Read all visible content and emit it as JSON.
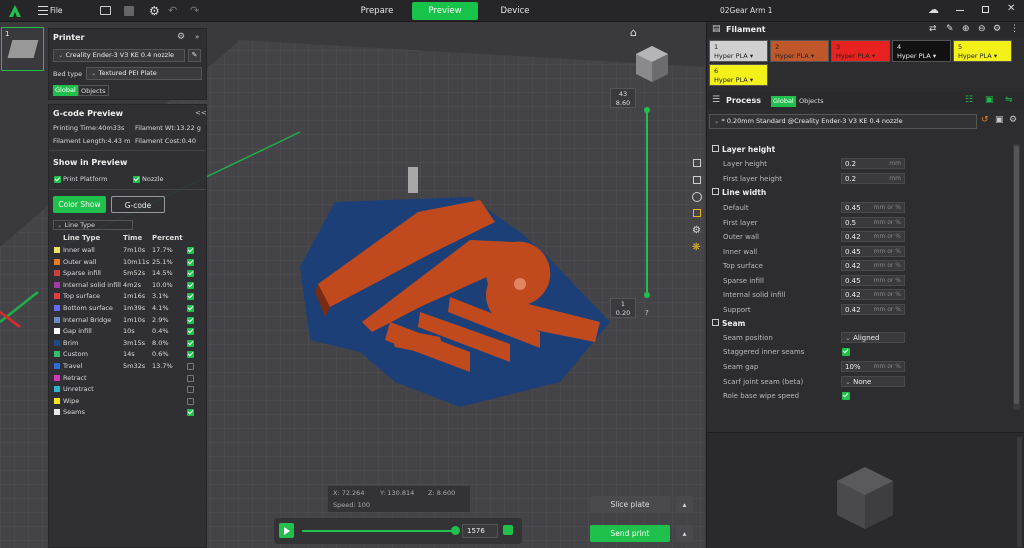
{
  "topbar": {
    "file": "File",
    "tabs": [
      "Prepare",
      "Preview",
      "Device"
    ],
    "title": "02Gear Arm 1"
  },
  "printer": {
    "heading": "Printer",
    "model": "Creality Ender-3 V3 KE 0.4 nozzle",
    "bed_label": "Bed type",
    "bed_value": "Textured PEI Plate",
    "global": "Global",
    "objects": "Objects"
  },
  "plate": {
    "number": "1"
  },
  "gcode": {
    "heading": "G-code Preview",
    "collapse": "<<",
    "print_time": "Printing Time:40m33s",
    "fil_wt": "Filament Wt:13.22 g",
    "fil_len": "Filament Length:4.43 m",
    "fil_cost": "Filament Cost:0.40",
    "show_heading": "Show in Preview",
    "print_platform": "Print Platform",
    "nozzle": "Nozzle",
    "color_show": "Color Show",
    "gcode_btn": "G-code",
    "line_type_select": "Line Type",
    "cols": [
      "Line Type",
      "Time",
      "Percent"
    ],
    "rows": [
      {
        "name": "Inner wall",
        "time": "7m10s",
        "pct": "17.7%",
        "color": "#f0e35a",
        "on": true
      },
      {
        "name": "Outer wall",
        "time": "10m11s",
        "pct": "25.1%",
        "color": "#e97c1f",
        "on": true
      },
      {
        "name": "Sparse infill",
        "time": "5m52s",
        "pct": "14.5%",
        "color": "#c9433a",
        "on": true
      },
      {
        "name": "Internal solid infill",
        "time": "4m2s",
        "pct": "10.0%",
        "color": "#a43aa8",
        "on": true
      },
      {
        "name": "Top surface",
        "time": "1m16s",
        "pct": "3.1%",
        "color": "#e23c44",
        "on": true
      },
      {
        "name": "Bottom surface",
        "time": "1m39s",
        "pct": "4.1%",
        "color": "#6a6cf0",
        "on": true
      },
      {
        "name": "Internal Bridge",
        "time": "1m10s",
        "pct": "2.9%",
        "color": "#6a8cc9",
        "on": true
      },
      {
        "name": "Gap infill",
        "time": "10s",
        "pct": "0.4%",
        "color": "#ffffff",
        "on": true
      },
      {
        "name": "Brim",
        "time": "3m15s",
        "pct": "8.0%",
        "color": "#1e4a8a",
        "on": true
      },
      {
        "name": "Custom",
        "time": "14s",
        "pct": "0.6%",
        "color": "#2bc26a",
        "on": true
      },
      {
        "name": "Travel",
        "time": "5m32s",
        "pct": "13.7%",
        "color": "#2b6cd6",
        "on": false
      },
      {
        "name": "Retract",
        "time": "",
        "pct": "",
        "color": "#d43ab8",
        "on": false
      },
      {
        "name": "Unretract",
        "time": "",
        "pct": "",
        "color": "#2bb6c9",
        "on": false
      },
      {
        "name": "Wipe",
        "time": "",
        "pct": "",
        "color": "#f5e61e",
        "on": false
      },
      {
        "name": "Seams",
        "time": "",
        "pct": "",
        "color": "#e8e8e8",
        "on": true
      }
    ]
  },
  "slider": {
    "top_layer": "43",
    "top_h": "8.60",
    "bot_layer": "1",
    "bot_h": "0.20",
    "q": "?"
  },
  "coords": {
    "x": "X: 72.264",
    "y": "Y: 130.814",
    "z": "Z: 8.600",
    "speed": "Speed: 100"
  },
  "bottom": {
    "layer_value": "1576"
  },
  "actions": {
    "slice": "Slice plate",
    "send": "Send print"
  },
  "filament": {
    "heading": "Filament",
    "items": [
      {
        "num": "1",
        "name": "Hyper PLA",
        "bg": "#d0d0d0",
        "fg": "#222"
      },
      {
        "num": "2",
        "name": "Hyper PLA",
        "bg": "#c0572a",
        "fg": "#222"
      },
      {
        "num": "3",
        "name": "Hyper PLA",
        "bg": "#e8221e",
        "fg": "#222"
      },
      {
        "num": "4",
        "name": "Hyper PLA",
        "bg": "#111111",
        "fg": "#eee"
      },
      {
        "num": "5",
        "name": "Hyper PLA",
        "bg": "#f4f01a",
        "fg": "#222"
      },
      {
        "num": "6",
        "name": "Hyper PLA",
        "bg": "#f4f01a",
        "fg": "#222"
      }
    ]
  },
  "process": {
    "heading": "Process",
    "global": "Global",
    "objects": "Objects",
    "profile": "* 0.20mm Standard @Creality Ender-3 V3 KE 0.4 nozzle",
    "layer_hdr": "Layer height",
    "layer_height": "Layer height",
    "layer_height_v": "0.2",
    "first_layer": "First layer height",
    "first_layer_v": "0.2",
    "lw_hdr": "Line width",
    "lw": [
      {
        "n": "Default",
        "v": "0.45"
      },
      {
        "n": "First layer",
        "v": "0.5"
      },
      {
        "n": "Outer wall",
        "v": "0.42"
      },
      {
        "n": "Inner wall",
        "v": "0.45"
      },
      {
        "n": "Top surface",
        "v": "0.42"
      },
      {
        "n": "Sparse infill",
        "v": "0.45"
      },
      {
        "n": "Internal solid infill",
        "v": "0.42"
      },
      {
        "n": "Support",
        "v": "0.42"
      }
    ],
    "unit_mm": "mm",
    "unit_mmpct": "mm or %",
    "seam_hdr": "Seam",
    "seam_pos": "Seam position",
    "seam_pos_v": "Aligned",
    "staggered": "Staggered inner seams",
    "seam_gap": "Seam gap",
    "seam_gap_v": "10%",
    "scarf": "Scarf joint seam (beta)",
    "scarf_v": "None",
    "role": "Role base wipe speed"
  }
}
